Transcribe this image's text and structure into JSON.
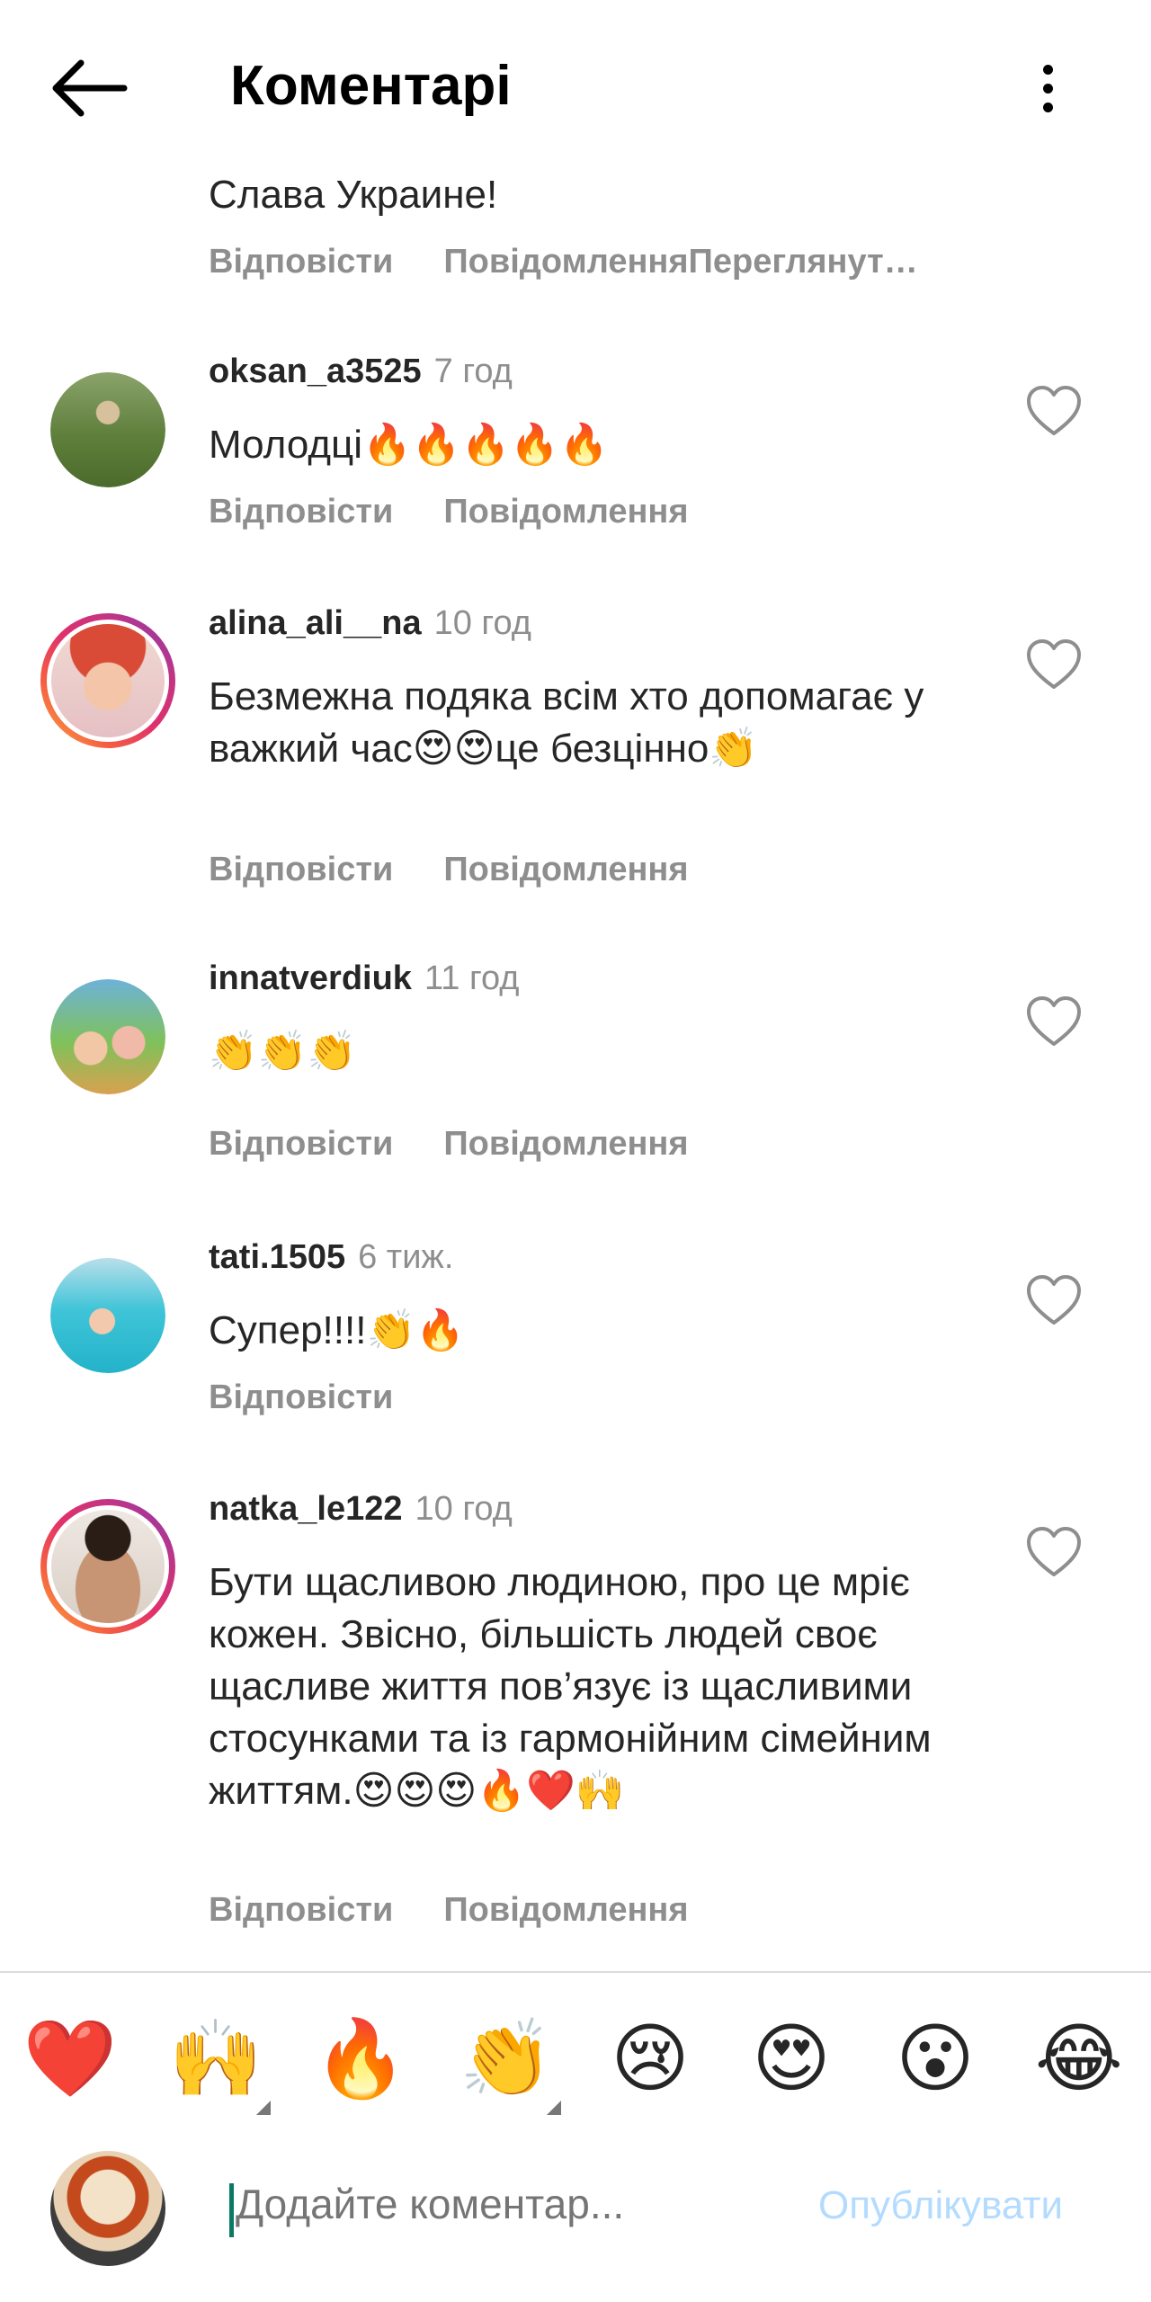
{
  "header": {
    "title": "Коментарі",
    "back_icon": "arrow-left-icon",
    "menu_icon": "more-vertical-icon"
  },
  "top_partial": {
    "text": "Слава Украине!",
    "reply": "Відповісти",
    "message": "Повідомлення",
    "view_replies": "Переглянут…"
  },
  "comments": [
    {
      "user": "oksan_a3525",
      "time": "7 год",
      "text": "Молодці🔥🔥🔥🔥🔥",
      "reply": "Відповісти",
      "message": "Повідомлення"
    },
    {
      "user": "alina_ali__na",
      "time": "10 год",
      "text": "Безмежна подяка всім хто допомагає у важкий час😍😍це безцінно👏",
      "reply": "Відповісти",
      "message": "Повідомлення"
    },
    {
      "user": "innatverdiuk",
      "time": "11 год",
      "text": "👏👏👏",
      "reply": "Відповісти",
      "message": "Повідомлення"
    },
    {
      "user": "tati.1505",
      "time": "6 тиж.",
      "text": "Супер!!!!👏🔥",
      "reply": "Відповісти"
    },
    {
      "user": "natka_le122",
      "time": "10 год",
      "text": "Бути щасливою людиною, про це мріє кожен. Звісно, більшість людей своє щасливе життя пов’язує із щасливими стосунками та із гармонійним сімейним життям.😍😍😍🔥❤️🙌",
      "reply": "Відповісти",
      "message": "Повідомлення"
    }
  ],
  "emoji_bar": [
    "❤️",
    "🙌",
    "🔥",
    "👏",
    "😢",
    "😍",
    "😮",
    "😂"
  ],
  "composer": {
    "placeholder": "Додайте коментар...",
    "publish": "Опублікувати"
  },
  "colors": {
    "username": "#262626",
    "meta": "#8e8e8e",
    "publish": "#b3dbff",
    "story_ring": "#e1306c"
  }
}
